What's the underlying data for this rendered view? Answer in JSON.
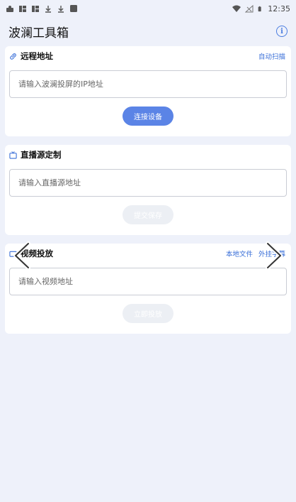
{
  "status": {
    "time": "12:35",
    "left_icons": [
      "notification-icon",
      "app-icon",
      "app-icon",
      "download-icon",
      "download-icon",
      "square-icon"
    ],
    "right_icons": [
      "wifi-icon",
      "signal-icon",
      "battery-icon"
    ]
  },
  "app": {
    "title": "波澜工具箱",
    "info_icon": "info-icon",
    "accent": "#4a7de0"
  },
  "remote": {
    "title": "远程地址",
    "icon": "link-icon",
    "link": "自动扫描",
    "placeholder": "请输入波澜投屏的IP地址",
    "button": "连接设备"
  },
  "live": {
    "title": "直播源定制",
    "icon": "tv-icon",
    "placeholder": "请输入直播源地址",
    "button": "提交保存"
  },
  "video": {
    "title": "视频投放",
    "icon": "video-icon",
    "link_local": "本地文件",
    "link_external": "外挂字幕",
    "placeholder": "请输入视频地址",
    "button": "立即投放"
  },
  "nav": {
    "prev_icon": "chevron-left-icon",
    "next_icon": "chevron-right-icon"
  }
}
